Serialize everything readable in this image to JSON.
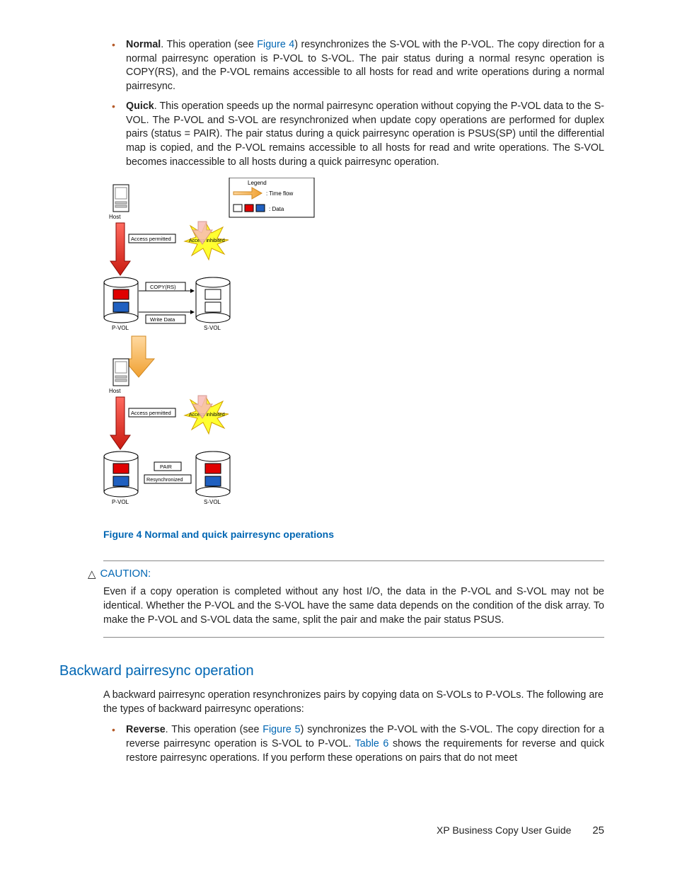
{
  "bullets_top": [
    {
      "label": "Normal",
      "pre": ". This operation (see ",
      "link": "Figure 4",
      "post": ") resynchronizes the S-VOL with the P-VOL. The copy direction for a normal pairresync operation is P-VOL to S-VOL. The pair status during a normal resync operation is COPY(RS), and the P-VOL remains accessible to all hosts for read and write operations during a normal pairresync."
    },
    {
      "label": "Quick",
      "text": ". This operation speeds up the normal pairresync operation without copying the P-VOL data to the S-VOL. The P-VOL and S-VOL are resynchronized when update copy operations are performed for duplex pairs (status = PAIR). The pair status during a quick pairresync operation is PSUS(SP) until the differential map is copied, and the P-VOL remains accessible to all hosts for read and write operations. The S-VOL becomes inaccessible to all hosts during a quick pairresync operation."
    }
  ],
  "diagram": {
    "legend_title": "Legend",
    "legend_time": ": Time flow",
    "legend_data": ": Data",
    "host": "Host",
    "access_permitted": "Access permitted",
    "access_inhibited": "Access inhibited",
    "copyrs": "COPY(RS)",
    "write_data": "Write Data",
    "pvol": "P-VOL",
    "svol": "S-VOL",
    "pair": "PAIR",
    "resync": "Resynchronized"
  },
  "figure_caption": "Figure 4 Normal and quick pairresync operations",
  "caution": {
    "heading": "CAUTION:",
    "text": "Even if a copy operation is completed without any host I/O, the data in the P-VOL and S-VOL may not be identical. Whether the P-VOL and the S-VOL have the same data depends on the condition of the disk array. To make the P-VOL and S-VOL data the same, split the pair and make the pair status PSUS."
  },
  "section_heading": "Backward pairresync operation",
  "section_intro": "A backward pairresync operation resynchronizes pairs by copying data on S-VOLs to P-VOLs. The following are the types of backward pairresync operations:",
  "bullets_bottom": [
    {
      "label": "Reverse",
      "pre": ". This operation (see ",
      "link1": "Figure 5",
      "mid": ") synchronizes the P-VOL with the S-VOL. The copy direction for a reverse pairresync operation is S-VOL to P-VOL. ",
      "link2": "Table 6",
      "post": " shows the requirements for reverse and quick restore pairresync operations. If you perform these operations on pairs that do not meet"
    }
  ],
  "footer": {
    "title": "XP Business Copy User Guide",
    "page": "25"
  }
}
